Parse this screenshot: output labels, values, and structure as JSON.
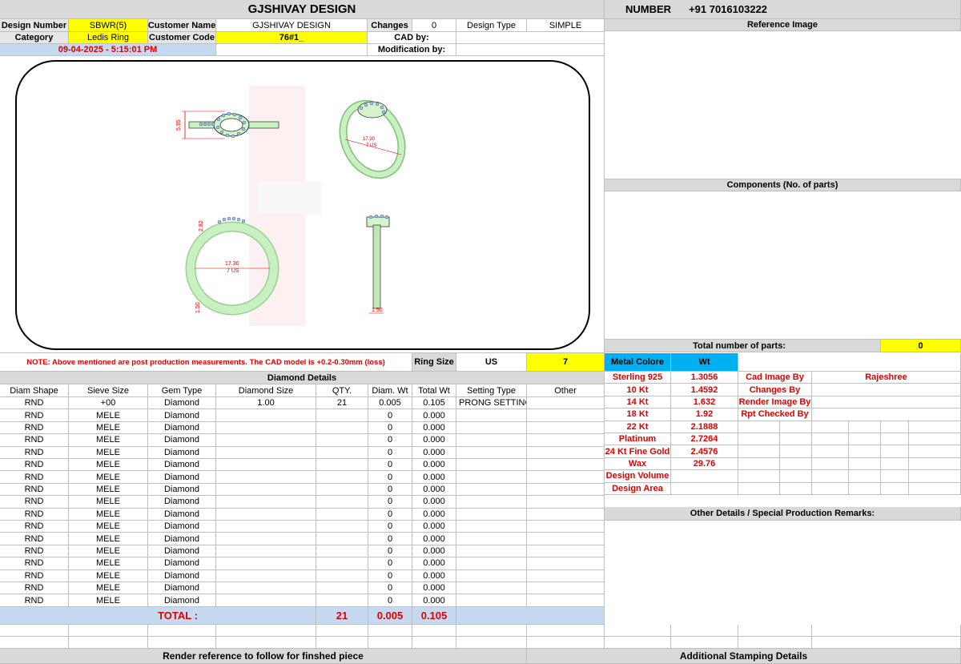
{
  "header": {
    "title": "GJSHIVAY DESIGN",
    "number_label": "NUMBER",
    "number_value": "+91 7016103222"
  },
  "info": {
    "design_number_label": "Design Number",
    "design_number": "SBWR(5)",
    "customer_name_label": "Customer Name",
    "customer_name": "GJSHIVAY DESIGN",
    "changes_label": "Changes",
    "changes": "0",
    "design_type_label": "Design Type",
    "design_type": "SIMPLE",
    "category_label": "Category",
    "category": "Ledis Ring",
    "customer_code_label": "Customer Code",
    "customer_code": "76#1_",
    "cad_by_label": "CAD by:",
    "date": "09-04-2025 - 5:15:01 PM",
    "modification_label": "Modification by:"
  },
  "right_panel": {
    "reference_image": "Reference Image",
    "components": "Components (No. of parts)",
    "total_parts_label": "Total number of parts:",
    "total_parts": "0",
    "other_details": "Other Details / Special Production Remarks:"
  },
  "cad": {
    "dims": {
      "top_height": "5.95",
      "persp_size": "17.30",
      "persp_us": "7 US",
      "front_top": "2.82",
      "front_size": "17.30",
      "front_us": "7 US",
      "front_bottom": "1.50",
      "side_bottom": "1.50"
    }
  },
  "note": {
    "text": "NOTE: Above mentioned are post production measurements. The CAD model is +0.2-0.30mm (loss)",
    "ring_size_label": "Ring Size",
    "ring_size_unit": "US",
    "ring_size": "7"
  },
  "diamond": {
    "title": "Diamond Details",
    "headers": [
      "Diam Shape",
      "Sieve Size",
      "Gem Type",
      "Diamond Size",
      "QTY.",
      "Diam. Wt",
      "Total Wt",
      "Setting Type",
      "Other"
    ],
    "rows": [
      [
        "RND",
        "+00",
        "Diamond",
        "1.00",
        "21",
        "0.005",
        "0.105",
        "PRONG SETTING",
        ""
      ],
      [
        "RND",
        "MELE",
        "Diamond",
        "",
        "",
        "0",
        "0.000",
        "",
        ""
      ],
      [
        "RND",
        "MELE",
        "Diamond",
        "",
        "",
        "0",
        "0.000",
        "",
        ""
      ],
      [
        "RND",
        "MELE",
        "Diamond",
        "",
        "",
        "0",
        "0.000",
        "",
        ""
      ],
      [
        "RND",
        "MELE",
        "Diamond",
        "",
        "",
        "0",
        "0.000",
        "",
        ""
      ],
      [
        "RND",
        "MELE",
        "Diamond",
        "",
        "",
        "0",
        "0.000",
        "",
        ""
      ],
      [
        "RND",
        "MELE",
        "Diamond",
        "",
        "",
        "0",
        "0.000",
        "",
        ""
      ],
      [
        "RND",
        "MELE",
        "Diamond",
        "",
        "",
        "0",
        "0.000",
        "",
        ""
      ],
      [
        "RND",
        "MELE",
        "Diamond",
        "",
        "",
        "0",
        "0.000",
        "",
        ""
      ],
      [
        "RND",
        "MELE",
        "Diamond",
        "",
        "",
        "0",
        "0.000",
        "",
        ""
      ],
      [
        "RND",
        "MELE",
        "Diamond",
        "",
        "",
        "0",
        "0.000",
        "",
        ""
      ],
      [
        "RND",
        "MELE",
        "Diamond",
        "",
        "",
        "0",
        "0.000",
        "",
        ""
      ],
      [
        "RND",
        "MELE",
        "Diamond",
        "",
        "",
        "0",
        "0.000",
        "",
        ""
      ],
      [
        "RND",
        "MELE",
        "Diamond",
        "",
        "",
        "0",
        "0.000",
        "",
        ""
      ],
      [
        "RND",
        "MELE",
        "Diamond",
        "",
        "",
        "0",
        "0.000",
        "",
        ""
      ],
      [
        "RND",
        "MELE",
        "Diamond",
        "",
        "",
        "0",
        "0.000",
        "",
        ""
      ],
      [
        "RND",
        "MELE",
        "Diamond",
        "",
        "",
        "0",
        "0.000",
        "",
        ""
      ]
    ],
    "total_label": "TOTAL :",
    "total_qty": "21",
    "total_diam_wt": "0.005",
    "total_wt": "0.105"
  },
  "metal": {
    "header_label": "Metal Colore",
    "header_wt": "Wt",
    "rows": [
      {
        "name": "Sterling 925",
        "wt": "1.3056"
      },
      {
        "name": "10 Kt",
        "wt": "1.4592"
      },
      {
        "name": "14 Kt",
        "wt": "1.632"
      },
      {
        "name": "18 Kt",
        "wt": "1.92"
      },
      {
        "name": "22 Kt",
        "wt": "2.1888"
      },
      {
        "name": "Platinum",
        "wt": "2.7264"
      },
      {
        "name": "24 Kt Fine Gold",
        "wt": "2.4576"
      },
      {
        "name": "Wax",
        "wt": "29.76"
      },
      {
        "name": "Design Volume",
        "wt": ""
      },
      {
        "name": "Design Area",
        "wt": ""
      }
    ],
    "cad_image_by_label": "Cad Image By",
    "cad_image_by": "Rajeshree",
    "changes_by_label": "Changes By",
    "render_image_by_label": "Render Image By",
    "rpt_checked_by_label": "Rpt Checked By"
  },
  "footer": {
    "render_reference": "Render reference to follow for finshed piece",
    "stamping": "Additional Stamping Details"
  },
  "colors": {
    "yellow": "#ffff00",
    "blue": "#00b0f0",
    "light_blue": "#c5d9f1",
    "gray": "#d9d9d9",
    "red": "#e00000",
    "ring_green": "#c8f0c0"
  }
}
